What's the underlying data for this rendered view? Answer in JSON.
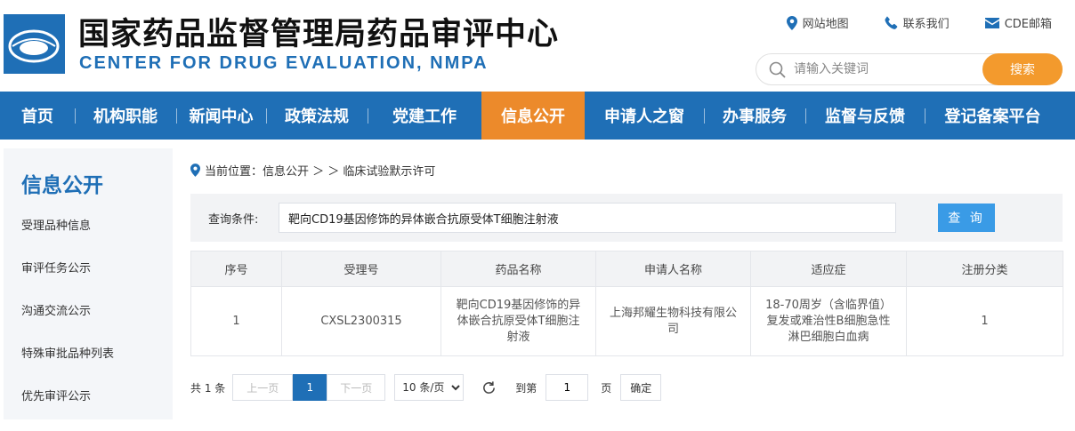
{
  "header": {
    "title_cn": "国家药品监督管理局药品审评中心",
    "title_en": "CENTER FOR DRUG EVALUATION, NMPA",
    "top_links": [
      {
        "label": "网站地图",
        "icon": "location-pin-icon"
      },
      {
        "label": "联系我们",
        "icon": "phone-icon"
      },
      {
        "label": "CDE邮箱",
        "icon": "mail-icon"
      }
    ],
    "search": {
      "placeholder": "请输入关键词",
      "button": "搜索"
    }
  },
  "nav": {
    "items": [
      {
        "label": "首页"
      },
      {
        "label": "机构职能"
      },
      {
        "label": "新闻中心"
      },
      {
        "label": "政策法规"
      },
      {
        "label": "党建工作"
      },
      {
        "label": "信息公开",
        "active": true
      },
      {
        "label": "申请人之窗"
      },
      {
        "label": "办事服务"
      },
      {
        "label": "监督与反馈"
      },
      {
        "label": "登记备案平台"
      }
    ]
  },
  "sidebar": {
    "title": "信息公开",
    "items": [
      "受理品种信息",
      "审评任务公示",
      "沟通交流公示",
      "特殊审批品种列表",
      "优先审评公示"
    ]
  },
  "breadcrumb": {
    "text": "当前位置：信息公开 ＞ ＞ 临床试验默示许可"
  },
  "query": {
    "label": "查询条件:",
    "value": "靶向CD19基因修饰的异体嵌合抗原受体T细胞注射液",
    "button": "查 询"
  },
  "table": {
    "headers": [
      "序号",
      "受理号",
      "药品名称",
      "申请人名称",
      "适应症",
      "注册分类"
    ],
    "rows": [
      [
        "1",
        "CXSL2300315",
        "靶向CD19基因修饰的异体嵌合抗原受体T细胞注射液",
        "上海邦耀生物科技有限公司",
        "18-70周岁（含临界值）复发或难治性B细胞急性淋巴细胞白血病",
        "1"
      ]
    ]
  },
  "pager": {
    "total": "共 1 条",
    "prev": "上一页",
    "current": "1",
    "next": "下一页",
    "page_size": "10 条/页",
    "goto_label": "到第",
    "goto_value": "1",
    "page_unit": "页",
    "confirm": "确定"
  },
  "colors": {
    "brand_blue": "#1f6fb6",
    "accent_orange": "#ec8a2b",
    "search_orange": "#f39a2d",
    "query_blue": "#3a9be6"
  }
}
